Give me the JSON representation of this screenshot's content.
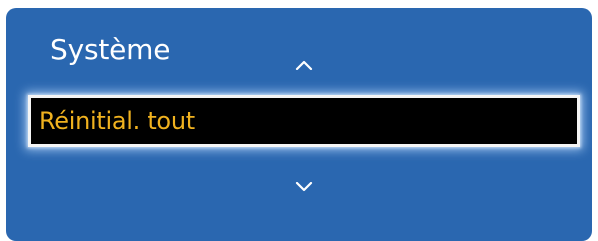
{
  "menu": {
    "title": "Système",
    "selected_item": {
      "label": "Réinitial. tout"
    },
    "scroll_up_icon": "chevron-up-icon",
    "scroll_down_icon": "chevron-down-icon"
  },
  "colors": {
    "panel_background": "#2a67b0",
    "selected_background": "#000000",
    "selected_border": "#f5f5f5",
    "selected_text": "#f0b21f",
    "title_text": "#ffffff"
  }
}
